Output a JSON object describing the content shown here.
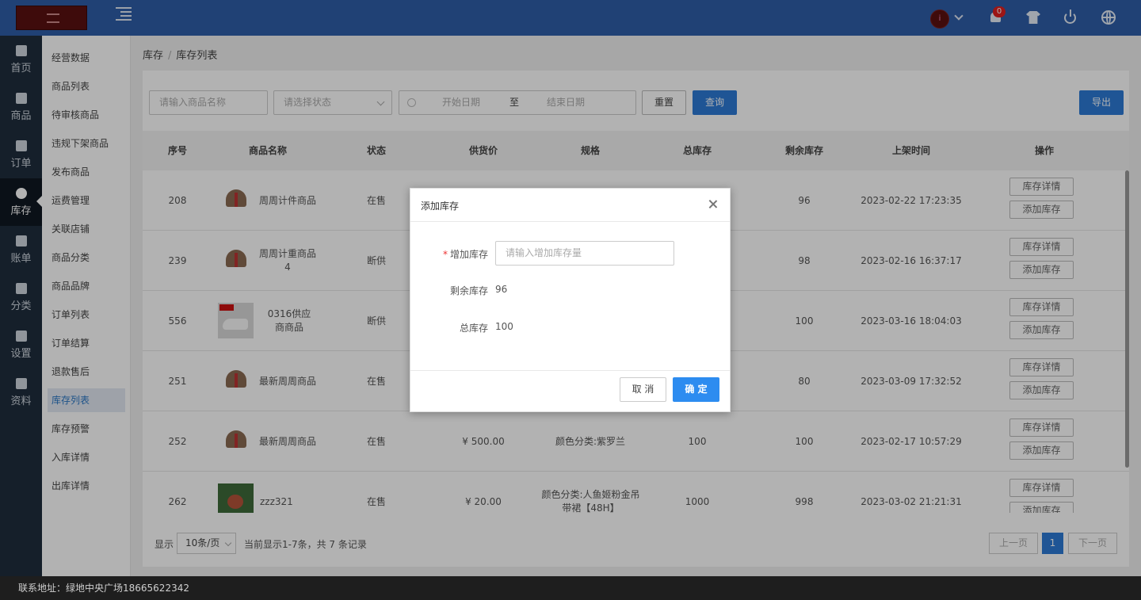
{
  "header": {
    "notification_count": "0",
    "avatar_initial": "i",
    "icons": [
      "menu-toggle-icon",
      "chevron-down-icon",
      "bell-icon",
      "shirt-icon",
      "power-icon",
      "globe-icon"
    ]
  },
  "nav": {
    "items": [
      {
        "label": "首页",
        "icon": "home-icon"
      },
      {
        "label": "商品",
        "icon": "product-icon"
      },
      {
        "label": "订单",
        "icon": "order-icon"
      },
      {
        "label": "库存",
        "icon": "pie-chart-icon"
      },
      {
        "label": "账单",
        "icon": "bill-icon"
      },
      {
        "label": "分类",
        "icon": "category-icon"
      },
      {
        "label": "设置",
        "icon": "puzzle-icon"
      },
      {
        "label": "资料",
        "icon": "image-icon"
      }
    ]
  },
  "subnav": {
    "items": [
      "经营数据",
      "商品列表",
      "待审核商品",
      "违规下架商品",
      "发布商品",
      "运费管理",
      "关联店铺",
      "商品分类",
      "商品品牌",
      "订单列表",
      "订单结算",
      "退款售后",
      "库存列表",
      "库存预警",
      "入库详情",
      "出库详情"
    ],
    "active": "库存列表"
  },
  "breadcrumb": {
    "root": "库存",
    "sep": "/",
    "current": "库存列表"
  },
  "filters": {
    "name_placeholder": "请输入商品名称",
    "status_placeholder": "请选择状态",
    "start_placeholder": "开始日期",
    "to_label": "至",
    "end_placeholder": "结束日期",
    "reset": "重置",
    "search": "查询",
    "export": "导出"
  },
  "table": {
    "columns": [
      "序号",
      "商品名称",
      "状态",
      "供货价",
      "规格",
      "总库存",
      "剩余库存",
      "上架时间",
      "操作"
    ],
    "rows": [
      {
        "id": "208",
        "name": "周周计件商品",
        "status": "在售",
        "price": "",
        "spec": "",
        "total": "",
        "remain": "96",
        "time": "2023-02-22 17:23:35"
      },
      {
        "id": "239",
        "name": "周周计重商品4",
        "status": "断供",
        "price": "",
        "spec": "",
        "total": "",
        "remain": "98",
        "time": "2023-02-16 16:37:17"
      },
      {
        "id": "556",
        "name": "0316供应商商品",
        "status": "断供",
        "price": "",
        "spec": "",
        "total": "",
        "remain": "100",
        "time": "2023-03-16 18:04:03"
      },
      {
        "id": "251",
        "name": "最新周周商品",
        "status": "在售",
        "price": "",
        "spec": "",
        "total": "",
        "remain": "80",
        "time": "2023-03-09 17:32:52"
      },
      {
        "id": "252",
        "name": "最新周周商品",
        "status": "在售",
        "price": "¥ 500.00",
        "spec": "颜色分类:紫罗兰",
        "total": "100",
        "remain": "100",
        "time": "2023-02-17 10:57:29"
      },
      {
        "id": "262",
        "name": "zzz321",
        "status": "在售",
        "price": "¥ 20.00",
        "spec": "颜色分类:人鱼姬粉金吊带裙【48H】",
        "total": "1000",
        "remain": "998",
        "time": "2023-03-02 21:21:31"
      }
    ],
    "op_detail": "库存详情",
    "op_add": "添加库存"
  },
  "pager": {
    "show_label": "显示",
    "page_size": "10条/页",
    "summary": "当前显示1-7条，共 7 条记录",
    "prev": "上一页",
    "current": "1",
    "next": "下一页"
  },
  "footer": {
    "text": "联系地址：绿地中央广场18665622342"
  },
  "modal": {
    "title": "添加库存",
    "add_label": "增加库存",
    "add_placeholder": "请输入增加库存量",
    "remain_label": "剩余库存",
    "remain_value": "96",
    "total_label": "总库存",
    "total_value": "100",
    "cancel": "取 消",
    "ok": "确 定"
  }
}
